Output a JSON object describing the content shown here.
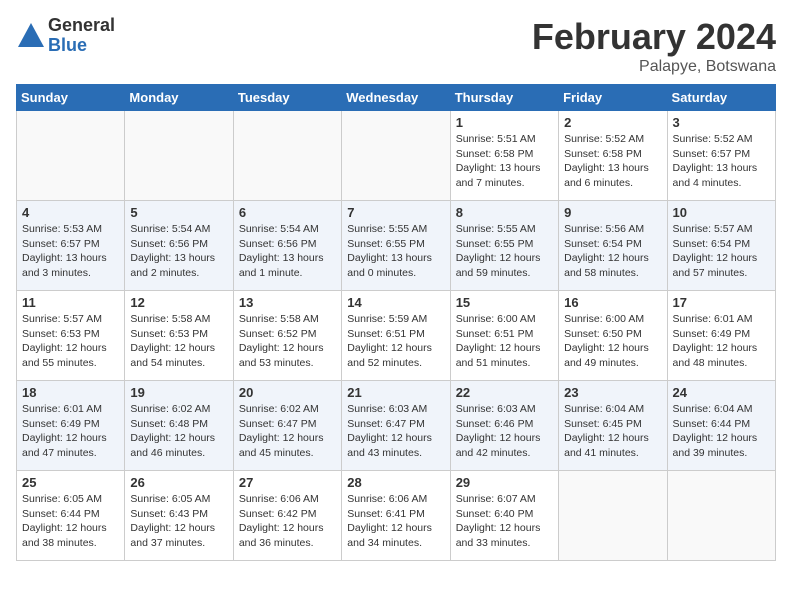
{
  "logo": {
    "general": "General",
    "blue": "Blue"
  },
  "title": "February 2024",
  "subtitle": "Palapye, Botswana",
  "headers": [
    "Sunday",
    "Monday",
    "Tuesday",
    "Wednesday",
    "Thursday",
    "Friday",
    "Saturday"
  ],
  "weeks": [
    [
      {
        "num": "",
        "info": ""
      },
      {
        "num": "",
        "info": ""
      },
      {
        "num": "",
        "info": ""
      },
      {
        "num": "",
        "info": ""
      },
      {
        "num": "1",
        "info": "Sunrise: 5:51 AM\nSunset: 6:58 PM\nDaylight: 13 hours\nand 7 minutes."
      },
      {
        "num": "2",
        "info": "Sunrise: 5:52 AM\nSunset: 6:58 PM\nDaylight: 13 hours\nand 6 minutes."
      },
      {
        "num": "3",
        "info": "Sunrise: 5:52 AM\nSunset: 6:57 PM\nDaylight: 13 hours\nand 4 minutes."
      }
    ],
    [
      {
        "num": "4",
        "info": "Sunrise: 5:53 AM\nSunset: 6:57 PM\nDaylight: 13 hours\nand 3 minutes."
      },
      {
        "num": "5",
        "info": "Sunrise: 5:54 AM\nSunset: 6:56 PM\nDaylight: 13 hours\nand 2 minutes."
      },
      {
        "num": "6",
        "info": "Sunrise: 5:54 AM\nSunset: 6:56 PM\nDaylight: 13 hours\nand 1 minute."
      },
      {
        "num": "7",
        "info": "Sunrise: 5:55 AM\nSunset: 6:55 PM\nDaylight: 13 hours\nand 0 minutes."
      },
      {
        "num": "8",
        "info": "Sunrise: 5:55 AM\nSunset: 6:55 PM\nDaylight: 12 hours\nand 59 minutes."
      },
      {
        "num": "9",
        "info": "Sunrise: 5:56 AM\nSunset: 6:54 PM\nDaylight: 12 hours\nand 58 minutes."
      },
      {
        "num": "10",
        "info": "Sunrise: 5:57 AM\nSunset: 6:54 PM\nDaylight: 12 hours\nand 57 minutes."
      }
    ],
    [
      {
        "num": "11",
        "info": "Sunrise: 5:57 AM\nSunset: 6:53 PM\nDaylight: 12 hours\nand 55 minutes."
      },
      {
        "num": "12",
        "info": "Sunrise: 5:58 AM\nSunset: 6:53 PM\nDaylight: 12 hours\nand 54 minutes."
      },
      {
        "num": "13",
        "info": "Sunrise: 5:58 AM\nSunset: 6:52 PM\nDaylight: 12 hours\nand 53 minutes."
      },
      {
        "num": "14",
        "info": "Sunrise: 5:59 AM\nSunset: 6:51 PM\nDaylight: 12 hours\nand 52 minutes."
      },
      {
        "num": "15",
        "info": "Sunrise: 6:00 AM\nSunset: 6:51 PM\nDaylight: 12 hours\nand 51 minutes."
      },
      {
        "num": "16",
        "info": "Sunrise: 6:00 AM\nSunset: 6:50 PM\nDaylight: 12 hours\nand 49 minutes."
      },
      {
        "num": "17",
        "info": "Sunrise: 6:01 AM\nSunset: 6:49 PM\nDaylight: 12 hours\nand 48 minutes."
      }
    ],
    [
      {
        "num": "18",
        "info": "Sunrise: 6:01 AM\nSunset: 6:49 PM\nDaylight: 12 hours\nand 47 minutes."
      },
      {
        "num": "19",
        "info": "Sunrise: 6:02 AM\nSunset: 6:48 PM\nDaylight: 12 hours\nand 46 minutes."
      },
      {
        "num": "20",
        "info": "Sunrise: 6:02 AM\nSunset: 6:47 PM\nDaylight: 12 hours\nand 45 minutes."
      },
      {
        "num": "21",
        "info": "Sunrise: 6:03 AM\nSunset: 6:47 PM\nDaylight: 12 hours\nand 43 minutes."
      },
      {
        "num": "22",
        "info": "Sunrise: 6:03 AM\nSunset: 6:46 PM\nDaylight: 12 hours\nand 42 minutes."
      },
      {
        "num": "23",
        "info": "Sunrise: 6:04 AM\nSunset: 6:45 PM\nDaylight: 12 hours\nand 41 minutes."
      },
      {
        "num": "24",
        "info": "Sunrise: 6:04 AM\nSunset: 6:44 PM\nDaylight: 12 hours\nand 39 minutes."
      }
    ],
    [
      {
        "num": "25",
        "info": "Sunrise: 6:05 AM\nSunset: 6:44 PM\nDaylight: 12 hours\nand 38 minutes."
      },
      {
        "num": "26",
        "info": "Sunrise: 6:05 AM\nSunset: 6:43 PM\nDaylight: 12 hours\nand 37 minutes."
      },
      {
        "num": "27",
        "info": "Sunrise: 6:06 AM\nSunset: 6:42 PM\nDaylight: 12 hours\nand 36 minutes."
      },
      {
        "num": "28",
        "info": "Sunrise: 6:06 AM\nSunset: 6:41 PM\nDaylight: 12 hours\nand 34 minutes."
      },
      {
        "num": "29",
        "info": "Sunrise: 6:07 AM\nSunset: 6:40 PM\nDaylight: 12 hours\nand 33 minutes."
      },
      {
        "num": "",
        "info": ""
      },
      {
        "num": "",
        "info": ""
      }
    ]
  ]
}
